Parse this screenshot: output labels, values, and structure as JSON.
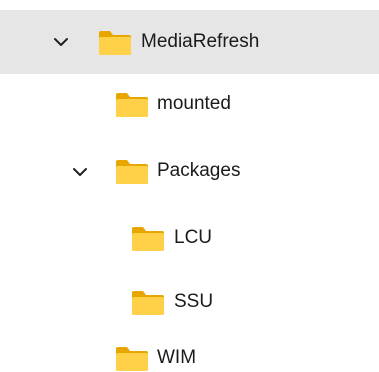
{
  "tree": {
    "items": [
      {
        "label": "MediaRefresh",
        "expanded": true,
        "selected": true,
        "icon": "folder-icon"
      },
      {
        "label": "mounted",
        "expanded": false,
        "selected": false,
        "icon": "folder-icon"
      },
      {
        "label": "Packages",
        "expanded": true,
        "selected": false,
        "icon": "folder-icon"
      },
      {
        "label": "LCU",
        "expanded": false,
        "selected": false,
        "icon": "folder-icon"
      },
      {
        "label": "SSU",
        "expanded": false,
        "selected": false,
        "icon": "folder-icon"
      },
      {
        "label": "WIM",
        "expanded": false,
        "selected": false,
        "icon": "folder-icon"
      }
    ]
  },
  "colors": {
    "selection": "#e6e6e6",
    "folder_back": "#e8a600",
    "folder_front": "#ffd148",
    "text": "#1b1b1b"
  }
}
